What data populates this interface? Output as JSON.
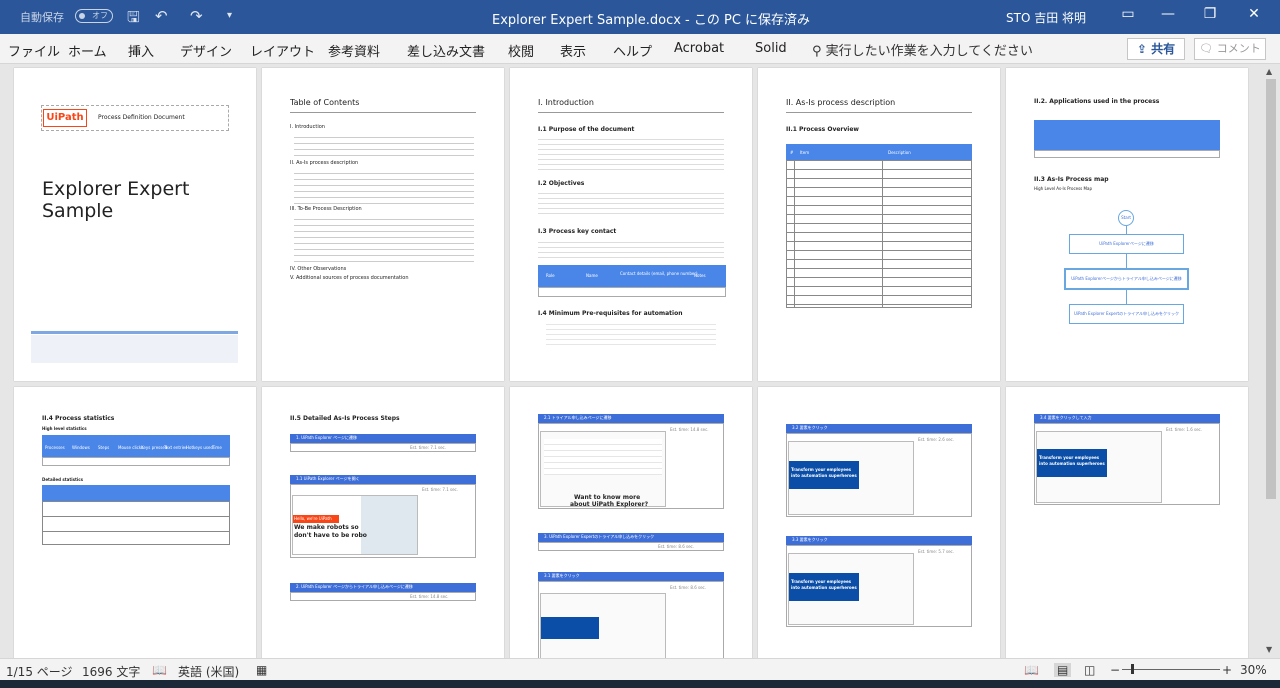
{
  "titlebar": {
    "autosave": "自動保存",
    "autosave_state": "オフ",
    "doc_title": "Explorer Expert Sample.docx - この PC に保存済み",
    "user": "STO 吉田 将明"
  },
  "menu": [
    "ファイル",
    "ホーム",
    "挿入",
    "デザイン",
    "レイアウト",
    "参考資料",
    "差し込み文書",
    "校閲",
    "表示",
    "ヘルプ",
    "Acrobat",
    "Solid"
  ],
  "search_text": "実行したい作業を入力してください",
  "share": "共有",
  "comment": "コメント",
  "pages": {
    "p1": {
      "logo": "UiPath",
      "header": "Process Definition Document",
      "title1": "Explorer Expert",
      "title2": "Sample"
    },
    "p2": {
      "title": "Table of Contents",
      "e1": "I.  Introduction",
      "e2": "II.  As-Is process description",
      "e3": "III.  To-Be Process Description",
      "e4": "IV.  Other Observations",
      "e5": "V.  Additional sources of process documentation"
    },
    "p3": {
      "title": "I.  Introduction",
      "s1": "I.1 Purpose of the document",
      "s2": "I.2 Objectives",
      "s3": "I.3 Process key contact",
      "s4": "I.4 Minimum Pre-requisites for automation",
      "th1": "Role",
      "th2": "Name",
      "th3": "Contact details (email, phone number)",
      "th4": "Notes"
    },
    "p4": {
      "title": "II.  As-Is process description",
      "s1": "II.1 Process Overview",
      "th1": "#",
      "th2": "Item",
      "th3": "Description"
    },
    "p5": {
      "s1": "II.2. Applications used in the process",
      "s2": "II.3 As-Is Process map",
      "s3": "High Level As-Is Process Map",
      "start": "Start",
      "f1": "UiPath Explorerページに遷移",
      "f2": "UiPath Explorerページからトライアル申し込みページに遷移",
      "f3": "UiPath Explorer Expertのトライアル申し込みをクリック"
    },
    "p6": {
      "s1": "II.4 Process statistics",
      "s2": "High level statistics",
      "s3": "Detailed statistics",
      "h": [
        "Processes",
        "Windows",
        "Steps",
        "Mouse clicks",
        "Keys pressed",
        "Text entries",
        "Hotkeys used",
        "Time"
      ]
    },
    "p7": {
      "s1": "II.5 Detailed As-Is Process Steps",
      "b1": "1.  UiPath Explorer ページに遷移",
      "b2": "1.1  UiPath Explorer ページを開く",
      "b3": "2.  UiPath Explorer ページからトライアル申し込みページに遷移",
      "est1": "Est. time: 7.1 sec.",
      "est2": "Est. time: 14.8 sec.",
      "ad1": "Hello, we're UiPath",
      "ad2": "We make robots so",
      "ad3": "don't have to be robo"
    },
    "p8": {
      "b1": "2.1  トライアル申し込みページに遷移",
      "b2": "3.  UiPath Explorer Expertのトライアル申し込みをクリック",
      "b3": "3.1  要素をクリック",
      "est1": "Est. time: 14.8 sec.",
      "est2": "Est. time: 8.6 sec.",
      "est3": "Est. time: 8.6 sec.",
      "want1": "Want to know more",
      "want2": "about UiPath Explorer?"
    },
    "p9": {
      "b1": "3.2  要素をクリック",
      "b2": "3.3  要素をクリック",
      "est1": "Est. time: 2.6 sec.",
      "est2": "Est. time: 5.7 sec.",
      "hero1": "Transform your employees",
      "hero2": "into automation superheroes"
    },
    "p10": {
      "b1": "3.4  要素をクリックして入力",
      "est1": "Est. time: 1.6 sec.",
      "hero1": "Transform your employees",
      "hero2": "into automation superheroes"
    }
  },
  "status": {
    "page": "1/15 ページ",
    "words": "1696 文字",
    "lang": "英語 (米国)",
    "zoom": "30%"
  },
  "colors": {
    "accent": "#2b579a",
    "blue": "#3e6fd8",
    "header_blue": "#4a86e8",
    "uipath": "#fa4616"
  }
}
